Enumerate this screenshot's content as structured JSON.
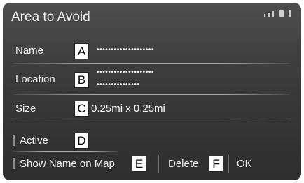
{
  "header": {
    "title": "Area to Avoid",
    "status_icons": [
      "signal-icon",
      "phone-icon",
      "bluetooth-icon"
    ]
  },
  "rows": {
    "name": {
      "label": "Name",
      "callout": "A",
      "value": "••••••••••••••••••••"
    },
    "location": {
      "label": "Location",
      "callout": "B",
      "value_line1": "••••••••••••••••••••",
      "value_line2": "•••••••••••••••"
    },
    "size": {
      "label": "Size",
      "callout": "C",
      "value": "0.25mi x 0.25mi"
    }
  },
  "buttons": {
    "active": {
      "label": "Active",
      "callout": "D"
    },
    "show_name": {
      "label": "Show Name on Map",
      "callout": "E"
    },
    "delete": {
      "label": "Delete",
      "callout": "F"
    },
    "ok": {
      "label": "OK"
    }
  },
  "colors": {
    "screen": "#3b3b3b",
    "text": "#eeeeee",
    "callout_bg": "#ffffff"
  }
}
